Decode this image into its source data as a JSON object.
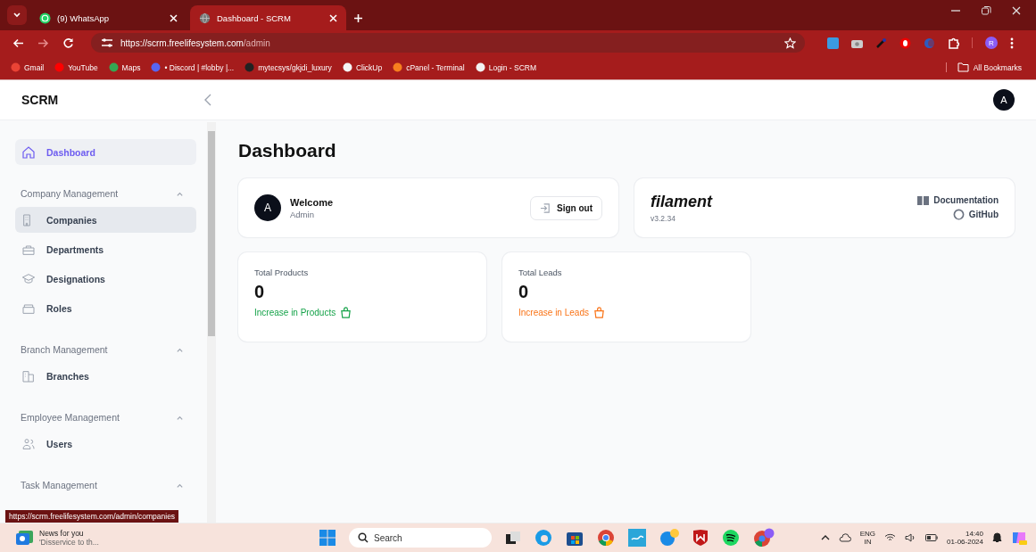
{
  "browser": {
    "tabs": [
      {
        "title": "(9) WhatsApp",
        "selected": false
      },
      {
        "title": "Dashboard - SCRM",
        "selected": true
      }
    ],
    "address": {
      "host": "https://scrm.freelifesystem.com",
      "path": "/admin"
    },
    "bookmarks": [
      "Gmail",
      "YouTube",
      "Maps",
      "• Discord | #lobby |...",
      "mytecsys/gkjdi_luxury",
      "ClickUp",
      "cPanel - Terminal",
      "Login - SCRM"
    ],
    "all_bookmarks": "All Bookmarks",
    "profile_initial": "R"
  },
  "app": {
    "brand": "SCRM",
    "user_initial": "A"
  },
  "sidebar": {
    "top": [
      {
        "label": "Dashboard",
        "selected": true
      }
    ],
    "groups": [
      {
        "label": "Company Management",
        "expanded": true,
        "children": [
          {
            "label": "Companies",
            "selected": false,
            "hovered": true
          },
          {
            "label": "Departments",
            "selected": false,
            "hovered": false
          },
          {
            "label": "Designations",
            "selected": false,
            "hovered": false
          },
          {
            "label": "Roles",
            "selected": false,
            "hovered": false
          }
        ]
      },
      {
        "label": "Branch Management",
        "expanded": true,
        "children": [
          {
            "label": "Branches",
            "selected": false,
            "hovered": false
          }
        ]
      },
      {
        "label": "Employee Management",
        "expanded": true,
        "children": [
          {
            "label": "Users",
            "selected": false,
            "hovered": false
          }
        ]
      },
      {
        "label": "Task Management",
        "expanded": true
      }
    ]
  },
  "main": {
    "title": "Dashboard",
    "welcome": {
      "avatar": "A",
      "greeting": "Welcome",
      "name": "Admin",
      "sign_out": "Sign out"
    },
    "filament": {
      "logo": "filament",
      "version": "v3.2.34",
      "links": [
        "Documentation",
        "GitHub"
      ]
    },
    "stats": [
      {
        "label": "Total Products",
        "value": "0",
        "description": "Increase in Products",
        "color": "#16a34a"
      },
      {
        "label": "Total Leads",
        "value": "0",
        "description": "Increase in Leads",
        "color": "#f97316"
      }
    ]
  },
  "status_url": "https://scrm.freelifesystem.com/admin/companies",
  "taskbar": {
    "news": {
      "title": "News for you",
      "subtitle": "'Disservice to th..."
    },
    "search": {
      "placeholder": "Search"
    },
    "language": [
      "ENG",
      "IN"
    ],
    "time": "14:40",
    "date": "01-06-2024"
  }
}
